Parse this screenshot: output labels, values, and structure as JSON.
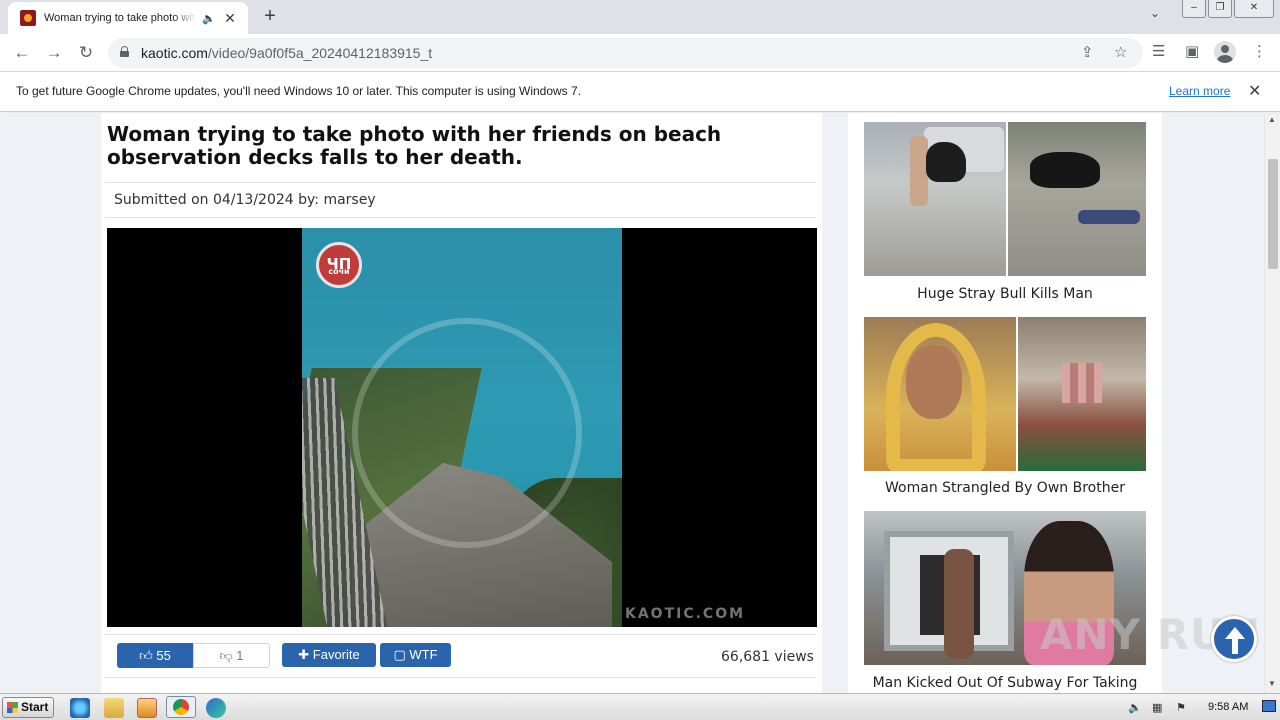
{
  "browser": {
    "tab_title": "Woman trying to take photo with her friends on beach observation decks falls to her death",
    "tab_audio_icon": "speaker-icon",
    "url_host": "kaotic.com",
    "url_path": "/video/9a0f0f5a_20240412183915_t",
    "infobar_message": "To get future Google Chrome updates, you'll need Windows 10 or later. This computer is using Windows 7.",
    "infobar_link": "Learn more"
  },
  "article": {
    "title": "Woman trying to take photo with her friends on beach observation decks falls to her death.",
    "submitted": "Submitted on 04/13/2024 by:  marsey",
    "video_logo_top": "ЧП",
    "video_logo_bottom": "сочи",
    "video_watermark": "KAOTIC.COM",
    "likes": "55",
    "dislikes": "1",
    "favorite_label": "Favorite",
    "wtf_label": "WTF",
    "views": "66,681 views"
  },
  "sidebar": {
    "items": [
      {
        "caption": "Huge Stray Bull Kills Man"
      },
      {
        "caption": "Woman Strangled By Own Brother"
      },
      {
        "caption": "Man Kicked Out Of Subway For Taking"
      }
    ]
  },
  "overlay": {
    "watermark_text": "ANY RUN"
  },
  "taskbar": {
    "start_label": "Start",
    "clock": "9:58 AM"
  },
  "colors": {
    "accent_blue": "#2a64ad",
    "page_bg": "#eef1f5",
    "link_blue": "#1a73e8"
  }
}
